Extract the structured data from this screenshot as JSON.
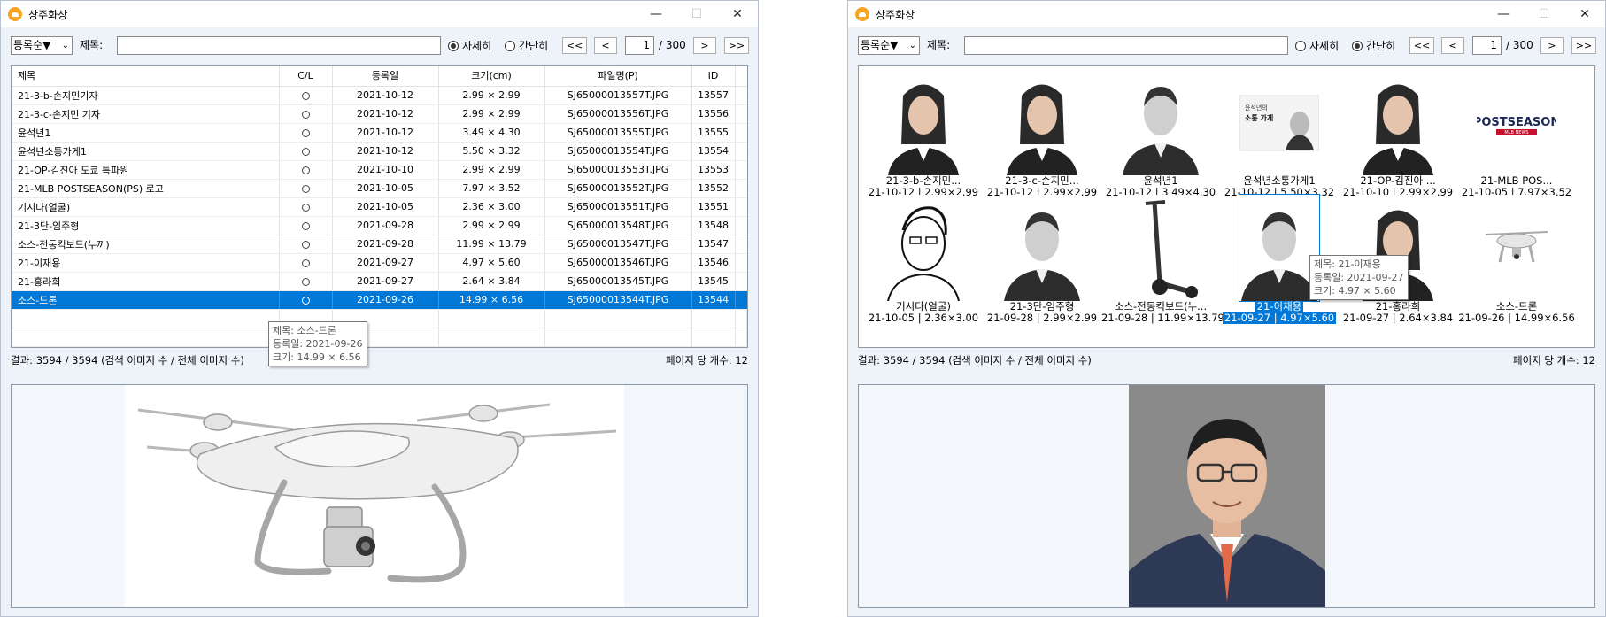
{
  "app_title": "상주화상",
  "colors": {
    "selection": "#0078d7",
    "app_icon": "#f7a324"
  },
  "toolbar": {
    "sort_label": "등록순▼",
    "title_label": "제목:",
    "title_value": "",
    "radio_detail": "자세히",
    "radio_simple": "간단히",
    "first": "<<",
    "prev": "<",
    "next": ">",
    "last": ">>",
    "page": "1",
    "total_pages": "/ 300"
  },
  "left": {
    "columns": [
      "제목",
      "C/L",
      "등록일",
      "크기(cm)",
      "파일명(P)",
      "ID"
    ],
    "rows": [
      {
        "title": "21-3-b-손지민기자",
        "date": "2021-10-12",
        "size": "2.99 × 2.99",
        "file": "SJ65000013557T.JPG",
        "id": "13557"
      },
      {
        "title": "21-3-c-손지민 기자",
        "date": "2021-10-12",
        "size": "2.99 × 2.99",
        "file": "SJ65000013556T.JPG",
        "id": "13556"
      },
      {
        "title": "윤석년1",
        "date": "2021-10-12",
        "size": "3.49 × 4.30",
        "file": "SJ65000013555T.JPG",
        "id": "13555"
      },
      {
        "title": "윤석년소통가게1",
        "date": "2021-10-12",
        "size": "5.50 × 3.32",
        "file": "SJ65000013554T.JPG",
        "id": "13554"
      },
      {
        "title": "21-OP-김진아 도쿄 특파원",
        "date": "2021-10-10",
        "size": "2.99 × 2.99",
        "file": "SJ65000013553T.JPG",
        "id": "13553"
      },
      {
        "title": "21-MLB POSTSEASON(PS) 로고",
        "date": "2021-10-05",
        "size": "7.97 × 3.52",
        "file": "SJ65000013552T.JPG",
        "id": "13552"
      },
      {
        "title": "기시다(얼굴)",
        "date": "2021-10-05",
        "size": "2.36 × 3.00",
        "file": "SJ65000013551T.JPG",
        "id": "13551"
      },
      {
        "title": "21-3단-임주형",
        "date": "2021-09-28",
        "size": "2.99 × 2.99",
        "file": "SJ65000013548T.JPG",
        "id": "13548"
      },
      {
        "title": "소스-전동킥보드(누끼)",
        "date": "2021-09-28",
        "size": "11.99 × 13.79",
        "file": "SJ65000013547T.JPG",
        "id": "13547"
      },
      {
        "title": "21-이재용",
        "date": "2021-09-27",
        "size": "4.97 × 5.60",
        "file": "SJ65000013546T.JPG",
        "id": "13546"
      },
      {
        "title": "21-홍라희",
        "date": "2021-09-27",
        "size": "2.64 × 3.84",
        "file": "SJ65000013545T.JPG",
        "id": "13545"
      },
      {
        "title": "소스-드론",
        "date": "2021-09-26",
        "size": "14.99 × 6.56",
        "file": "SJ65000013544T.JPG",
        "id": "13544"
      }
    ],
    "tooltip": [
      "제목: 소스-드론",
      "등록일: 2021-09-26",
      "크기: 14.99 × 6.56"
    ]
  },
  "right": {
    "thumbs": [
      {
        "name": "21-3-b-손지민...",
        "meta": "21-10-12 | 2.99×2.99",
        "icon": "woman-portrait-icon"
      },
      {
        "name": "21-3-c-손지민...",
        "meta": "21-10-12 | 2.99×2.99",
        "icon": "woman-portrait-icon"
      },
      {
        "name": "윤석년1",
        "meta": "21-10-12 | 3.49×4.30",
        "icon": "man-portrait-icon"
      },
      {
        "name": "윤석년소통가게1",
        "meta": "21-10-12 | 5.50×3.32",
        "icon": "book-cover-icon"
      },
      {
        "name": "21-OP-김진아 ...",
        "meta": "21-10-10 | 2.99×2.99",
        "icon": "woman-portrait-icon"
      },
      {
        "name": "21-MLB POS...",
        "meta": "21-10-05 | 7.97×3.52",
        "icon": "logo-icon"
      },
      {
        "name": "기시다(얼굴)",
        "meta": "21-10-05 | 2.36×3.00",
        "icon": "sketch-portrait-icon"
      },
      {
        "name": "21-3단-임주형",
        "meta": "21-09-28 | 2.99×2.99",
        "icon": "man-portrait-icon"
      },
      {
        "name": "소스-전동킥보드(누...",
        "meta": "21-09-28 | 11.99×13.79",
        "icon": "scooter-icon"
      },
      {
        "name": "21-이재용",
        "meta": "21-09-27 | 4.97×5.60",
        "icon": "man-portrait-icon"
      },
      {
        "name": "21-홍라희",
        "meta": "21-09-27 | 2.64×3.84",
        "icon": "woman-portrait-icon"
      },
      {
        "name": "소스-드론",
        "meta": "21-09-26 | 14.99×6.56",
        "icon": "drone-icon"
      }
    ],
    "logo_text_1": "POSTSEASON",
    "logo_text_2": "MLB NEWS",
    "book_text_1": "윤석년의",
    "book_text_2": "소통 가게",
    "tooltip": [
      "제목: 21-이재용",
      "등록일: 2021-09-27",
      "크기: 4.97 × 5.60"
    ]
  },
  "status": {
    "result": "결과: 3594 / 3594 (검색 이미지 수 / 전체 이미지 수)",
    "per_page": "페이지 당 개수: 12"
  }
}
